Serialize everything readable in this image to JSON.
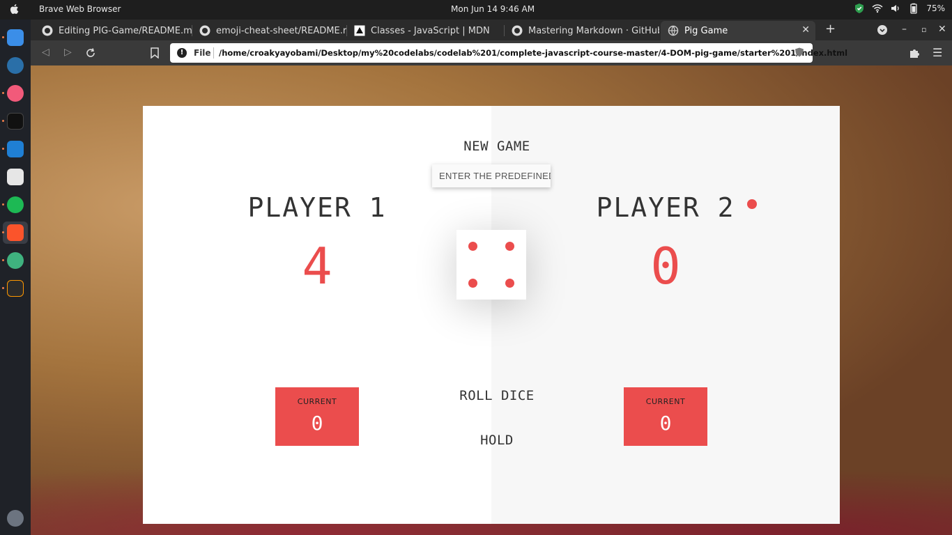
{
  "system": {
    "app_name": "Brave Web Browser",
    "clock": "Mon Jun 14   9:46 AM",
    "battery": "75%"
  },
  "tabs": [
    {
      "label": "Editing PIG-Game/README.m",
      "icon": "github-icon"
    },
    {
      "label": "emoji-cheat-sheet/README.r",
      "icon": "github-icon"
    },
    {
      "label": "Classes - JavaScript | MDN",
      "icon": "mdn-icon"
    },
    {
      "label": "Mastering Markdown · GitHub",
      "icon": "github-icon"
    },
    {
      "label": "Pig Game",
      "icon": "globe-icon",
      "active": true
    }
  ],
  "address_bar": {
    "scheme": "File",
    "url": "/home/croakyayobami/Desktop/my%20codelabs/codelab%201/complete-javascript-course-master/4-DOM-pig-game/starter%201/index.html"
  },
  "game": {
    "new_game_label": "NEW GAME",
    "input_placeholder": "ENTER THE PREDEFINED SCORE",
    "roll_label": "ROLL DICE",
    "hold_label": "HOLD",
    "dice_value": 4,
    "accent_color": "#eb4d4d",
    "players": [
      {
        "name": "PLAYER 1",
        "score": "4",
        "current_label": "CURRENT",
        "current": "0",
        "active": false
      },
      {
        "name": "PLAYER 2",
        "score": "0",
        "current_label": "CURRENT",
        "current": "0",
        "active": true
      }
    ]
  }
}
